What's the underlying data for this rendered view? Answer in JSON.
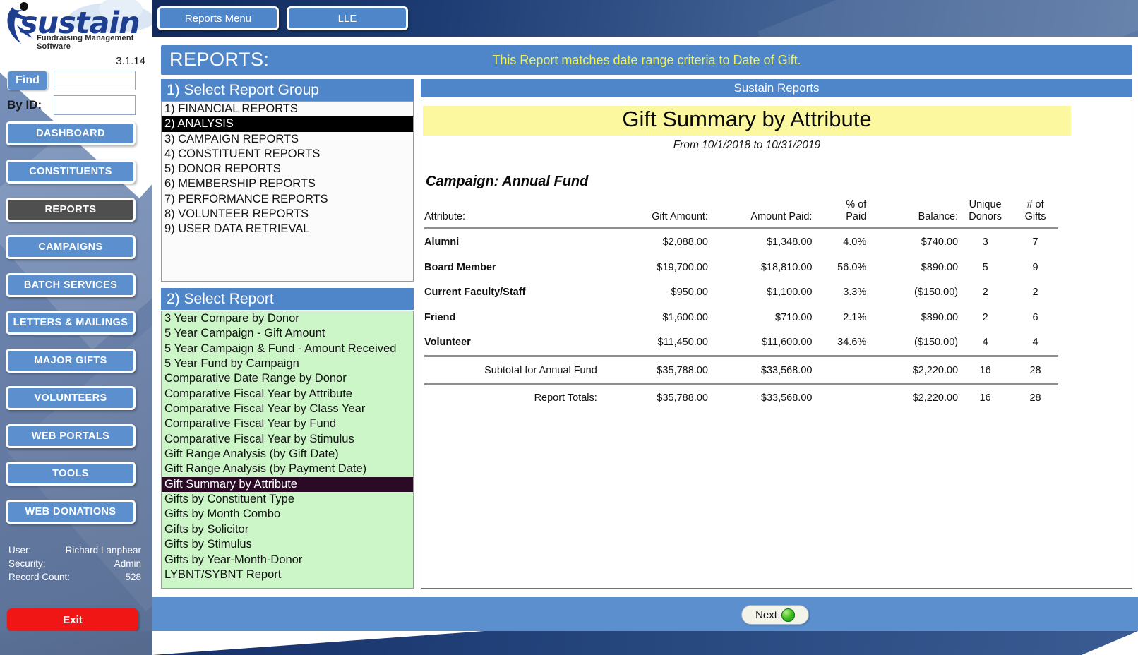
{
  "brand": {
    "name": "sustain",
    "tagline": "Fundraising Management Software",
    "version": "3.1.14"
  },
  "search": {
    "find_label": "Find",
    "find_value": "",
    "byid_label": "By ID:",
    "byid_value": ""
  },
  "sidebar": {
    "items": [
      {
        "label": "DASHBOARD",
        "active": false
      },
      {
        "label": "CONSTITUENTS",
        "active": false
      },
      {
        "label": "REPORTS",
        "active": true
      },
      {
        "label": "CAMPAIGNS",
        "active": false
      },
      {
        "label": "BATCH SERVICES",
        "active": false
      },
      {
        "label": "LETTERS & MAILINGS",
        "active": false
      },
      {
        "label": "MAJOR GIFTS",
        "active": false
      },
      {
        "label": "VOLUNTEERS",
        "active": false
      },
      {
        "label": "WEB PORTALS",
        "active": false
      },
      {
        "label": "TOOLS",
        "active": false
      },
      {
        "label": "WEB DONATIONS",
        "active": false
      }
    ],
    "user_label": "User:",
    "user_value": "Richard Lanphear",
    "security_label": "Security:",
    "security_value": "Admin",
    "record_count_label": "Record Count:",
    "record_count_value": "528",
    "exit_label": "Exit"
  },
  "topbar": {
    "tabs": [
      {
        "label": "Reports Menu"
      },
      {
        "label": "LLE"
      }
    ]
  },
  "header": {
    "title": "REPORTS:",
    "note": "This Report matches date range criteria to Date of Gift."
  },
  "group_panel": {
    "heading": "1) Select Report Group",
    "items": [
      {
        "label": "1) FINANCIAL REPORTS",
        "selected": false
      },
      {
        "label": "2) ANALYSIS",
        "selected": true
      },
      {
        "label": "3) CAMPAIGN REPORTS",
        "selected": false
      },
      {
        "label": "4) CONSTITUENT REPORTS",
        "selected": false
      },
      {
        "label": "5) DONOR REPORTS",
        "selected": false
      },
      {
        "label": "6) MEMBERSHIP REPORTS",
        "selected": false
      },
      {
        "label": "7) PERFORMANCE REPORTS",
        "selected": false
      },
      {
        "label": "8) VOLUNTEER REPORTS",
        "selected": false
      },
      {
        "label": "9) USER DATA RETRIEVAL",
        "selected": false
      }
    ]
  },
  "report_panel": {
    "heading": "2) Select Report",
    "items": [
      {
        "label": "3 Year Compare by Donor",
        "selected": false
      },
      {
        "label": "5 Year Campaign - Gift Amount",
        "selected": false
      },
      {
        "label": "5 Year Campaign & Fund - Amount Received",
        "selected": false
      },
      {
        "label": "5 Year Fund by Campaign",
        "selected": false
      },
      {
        "label": "Comparative Date Range by Donor",
        "selected": false
      },
      {
        "label": "Comparative Fiscal Year by Attribute",
        "selected": false
      },
      {
        "label": "Comparative Fiscal Year by Class Year",
        "selected": false
      },
      {
        "label": "Comparative Fiscal Year by Fund",
        "selected": false
      },
      {
        "label": "Comparative Fiscal Year by Stimulus",
        "selected": false
      },
      {
        "label": "Gift Range Analysis (by Gift Date)",
        "selected": false
      },
      {
        "label": "Gift Range Analysis (by Payment Date)",
        "selected": false
      },
      {
        "label": "Gift Summary by Attribute",
        "selected": true
      },
      {
        "label": "Gifts by Constituent Type",
        "selected": false
      },
      {
        "label": "Gifts by Month Combo",
        "selected": false
      },
      {
        "label": "Gifts by Solicitor",
        "selected": false
      },
      {
        "label": "Gifts by Stimulus",
        "selected": false
      },
      {
        "label": "Gifts by Year-Month-Donor",
        "selected": false
      },
      {
        "label": "LYBNT/SYBNT Report",
        "selected": false
      }
    ]
  },
  "viewer": {
    "banner": "Sustain Reports",
    "title": "Gift Summary by Attribute",
    "date_range": "From 10/1/2018 to 10/31/2019",
    "campaign": "Campaign: Annual Fund"
  },
  "chart_data": {
    "type": "table",
    "title": "Gift Summary by Attribute",
    "subtitle": "From 10/1/2018 to 10/31/2019",
    "group": "Campaign: Annual Fund",
    "columns": [
      "Attribute:",
      "Gift Amount:",
      "Amount Paid:",
      "% of\nPaid",
      "Balance:",
      "Unique\nDonors",
      "# of\nGifts"
    ],
    "rows": [
      {
        "attribute": "Alumni",
        "gift_amount": "$2,088.00",
        "amount_paid": "$1,348.00",
        "pct_paid": "4.0%",
        "balance": "$740.00",
        "unique_donors": "3",
        "num_gifts": "7"
      },
      {
        "attribute": "Board Member",
        "gift_amount": "$19,700.00",
        "amount_paid": "$18,810.00",
        "pct_paid": "56.0%",
        "balance": "$890.00",
        "unique_donors": "5",
        "num_gifts": "9"
      },
      {
        "attribute": "Current Faculty/Staff",
        "gift_amount": "$950.00",
        "amount_paid": "$1,100.00",
        "pct_paid": "3.3%",
        "balance": "($150.00)",
        "unique_donors": "2",
        "num_gifts": "2"
      },
      {
        "attribute": "Friend",
        "gift_amount": "$1,600.00",
        "amount_paid": "$710.00",
        "pct_paid": "2.1%",
        "balance": "$890.00",
        "unique_donors": "2",
        "num_gifts": "6"
      },
      {
        "attribute": "Volunteer",
        "gift_amount": "$11,450.00",
        "amount_paid": "$11,600.00",
        "pct_paid": "34.6%",
        "balance": "($150.00)",
        "unique_donors": "4",
        "num_gifts": "4"
      }
    ],
    "subtotal": {
      "label": "Subtotal for Annual Fund",
      "gift_amount": "$35,788.00",
      "amount_paid": "$33,568.00",
      "pct_paid": "",
      "balance": "$2,220.00",
      "unique_donors": "16",
      "num_gifts": "28"
    },
    "totals": {
      "label": "Report Totals:",
      "gift_amount": "$35,788.00",
      "amount_paid": "$33,568.00",
      "pct_paid": "",
      "balance": "$2,220.00",
      "unique_donors": "16",
      "num_gifts": "28"
    }
  },
  "footer": {
    "next_label": "Next",
    "next_icon": "green-orb-icon"
  },
  "colors": {
    "accent_blue": "#4f86c9",
    "nav_blue": "#5b8fce",
    "dark_navy": "#17306a",
    "highlight_yellow": "#fbf8a0",
    "note_yellow": "#eef35c",
    "list_green": "#ccf5c8",
    "exit_red": "#f01616",
    "selected_black": "#000000",
    "selected_purple": "#2b0a25"
  }
}
